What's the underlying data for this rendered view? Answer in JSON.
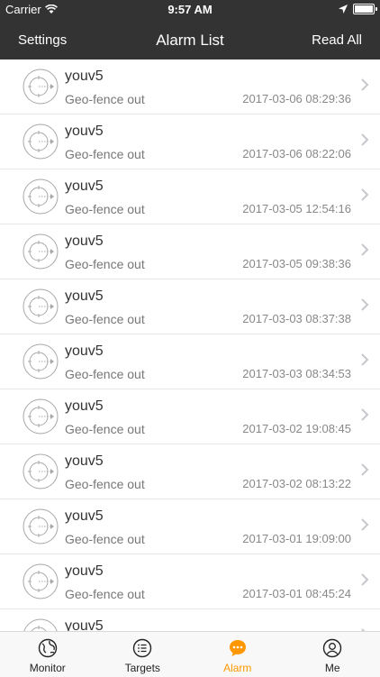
{
  "status_bar": {
    "carrier": "Carrier",
    "time": "9:57 AM"
  },
  "nav": {
    "left": "Settings",
    "title": "Alarm List",
    "right": "Read All"
  },
  "alarms": [
    {
      "name": "youv5",
      "type": "Geo-fence out",
      "time": "2017-03-06 08:29:36"
    },
    {
      "name": "youv5",
      "type": "Geo-fence out",
      "time": "2017-03-06 08:22:06"
    },
    {
      "name": "youv5",
      "type": "Geo-fence out",
      "time": "2017-03-05 12:54:16"
    },
    {
      "name": "youv5",
      "type": "Geo-fence out",
      "time": "2017-03-05 09:38:36"
    },
    {
      "name": "youv5",
      "type": "Geo-fence out",
      "time": "2017-03-03 08:37:38"
    },
    {
      "name": "youv5",
      "type": "Geo-fence out",
      "time": "2017-03-03 08:34:53"
    },
    {
      "name": "youv5",
      "type": "Geo-fence out",
      "time": "2017-03-02 19:08:45"
    },
    {
      "name": "youv5",
      "type": "Geo-fence out",
      "time": "2017-03-02 08:13:22"
    },
    {
      "name": "youv5",
      "type": "Geo-fence out",
      "time": "2017-03-01 19:09:00"
    },
    {
      "name": "youv5",
      "type": "Geo-fence out",
      "time": "2017-03-01 08:45:24"
    },
    {
      "name": "youv5",
      "type": "",
      "time": ""
    }
  ],
  "tabs": [
    {
      "label": "Monitor",
      "icon": "globe-icon",
      "active": false
    },
    {
      "label": "Targets",
      "icon": "list-icon",
      "active": false
    },
    {
      "label": "Alarm",
      "icon": "chat-bubble-icon",
      "active": true
    },
    {
      "label": "Me",
      "icon": "person-icon",
      "active": false
    }
  ],
  "colors": {
    "header_bg": "#333333",
    "accent": "#ff9800",
    "tabbar_bg": "#f8f8f8"
  }
}
